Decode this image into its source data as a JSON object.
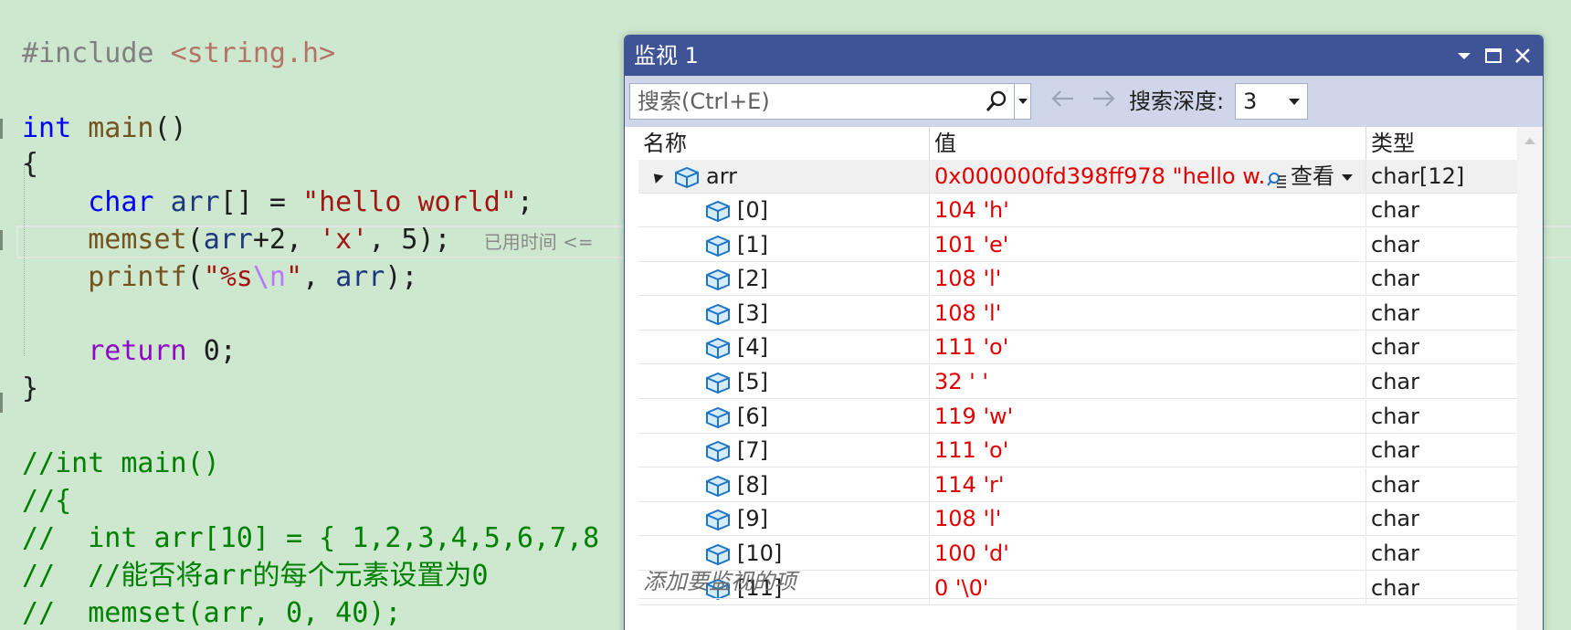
{
  "editor": {
    "inline_hint": "已用时间 <="
  },
  "watch": {
    "title": "监视 1",
    "search_placeholder": "搜索(Ctrl+E)",
    "depth_label": "搜索深度:",
    "depth_value": "3",
    "columns": [
      "名称",
      "值",
      "类型"
    ],
    "root": {
      "name": "arr",
      "value": "0x000000fd398ff978 \"hello w...",
      "view_label": "查看",
      "type": "char[12]"
    },
    "rows": [
      {
        "name": "[0]",
        "value": "104 'h'",
        "type": "char"
      },
      {
        "name": "[1]",
        "value": "101 'e'",
        "type": "char"
      },
      {
        "name": "[2]",
        "value": "108 'l'",
        "type": "char"
      },
      {
        "name": "[3]",
        "value": "108 'l'",
        "type": "char"
      },
      {
        "name": "[4]",
        "value": "111 'o'",
        "type": "char"
      },
      {
        "name": "[5]",
        "value": "32 ' '",
        "type": "char"
      },
      {
        "name": "[6]",
        "value": "119 'w'",
        "type": "char"
      },
      {
        "name": "[7]",
        "value": "111 'o'",
        "type": "char"
      },
      {
        "name": "[8]",
        "value": "114 'r'",
        "type": "char"
      },
      {
        "name": "[9]",
        "value": "108 'l'",
        "type": "char"
      },
      {
        "name": "[10]",
        "value": "100 'd'",
        "type": "char"
      },
      {
        "name": "[11]",
        "value": "0 '\\0'",
        "type": "char"
      }
    ],
    "add_item_placeholder": "添加要监视的项"
  }
}
